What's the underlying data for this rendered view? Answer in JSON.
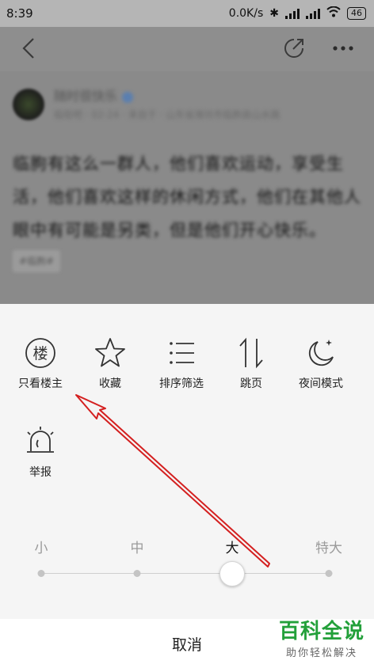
{
  "status_bar": {
    "time": "8:39",
    "network_speed": "0.0K/s",
    "battery": "46"
  },
  "post": {
    "author": "随时很快乐",
    "meta": "临街吧 · 02-24 · 来自于 · 山东省潍坊市临朐县山水路",
    "body": "临朐有这么一群人，他们喜欢运动，享受生活，他们喜欢这样的休闲方式，他们在其他人眼中有可能是另类，但是他们开心快乐。",
    "tag": "#临朐#"
  },
  "actions": [
    {
      "label": "只看楼主",
      "icon": "lou-circle-icon"
    },
    {
      "label": "收藏",
      "icon": "star-icon"
    },
    {
      "label": "排序筛选",
      "icon": "sort-list-icon"
    },
    {
      "label": "跳页",
      "icon": "jump-page-icon"
    },
    {
      "label": "夜间模式",
      "icon": "night-moon-icon"
    },
    {
      "label": "举报",
      "icon": "report-alarm-icon"
    }
  ],
  "lou_glyph": "楼",
  "font_size": {
    "options": [
      "小",
      "中",
      "大",
      "特大"
    ],
    "selected": "大"
  },
  "cancel_label": "取消",
  "watermark": {
    "title": "百科全说",
    "subtitle": "助你轻松解决"
  },
  "colors": {
    "sheet_bg": "#f5f5f5",
    "overlay": "#8a8a8a",
    "annotation_arrow": "#d42020",
    "watermark_green": "#23a03a"
  }
}
